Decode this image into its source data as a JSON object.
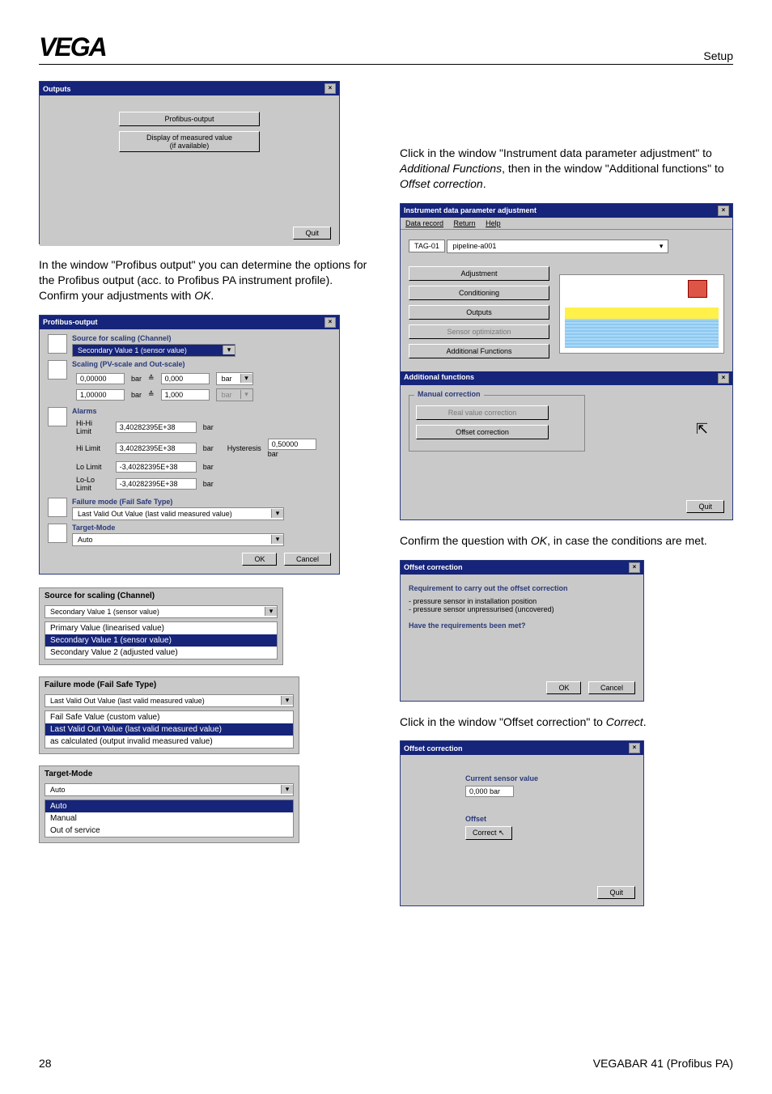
{
  "header": {
    "logo": "VEGA",
    "section": "Setup"
  },
  "left": {
    "win_outputs": {
      "title": "Outputs",
      "btn_profibus": "Profibus-output",
      "btn_display": "Display of measured value",
      "btn_avail": "(if available)",
      "quit": "Quit"
    },
    "para1a": "In the window \"Profibus output\" you can determine the options for the Profibus output (acc. to Profibus PA instrument profile). Confirm your adjustments with ",
    "para1b": ".",
    "ok_italic": "OK",
    "win_pb": {
      "title": "Profibus-output",
      "src_label": "Source for scaling (Channel)",
      "src_value": "Secondary Value 1 (sensor value)",
      "scale_label": "Scaling (PV-scale and Out-scale)",
      "row1_in": "0,00000",
      "row1_u1": "bar",
      "row1_eq": "≙",
      "row1_out": "0,000",
      "row1_u2": "bar",
      "row2_in": "1,00000",
      "row2_u1": "bar",
      "row2_eq": "≙",
      "row2_out": "1,000",
      "row2_u2": "bar",
      "alarms_label": "Alarms",
      "hihi": "Hi-Hi Limit",
      "hihi_v": "3,40282395E+38",
      "hihi_u": "bar",
      "hi": "Hi Limit",
      "hi_v": "3,40282395E+38",
      "hi_u": "bar",
      "hyst": "Hysteresis",
      "hyst_v": "0,50000",
      "hyst_u": "bar",
      "lo": "Lo Limit",
      "lo_v": "-3,40282395E+38",
      "lo_u": "bar",
      "lolo": "Lo-Lo Limit",
      "lolo_v": "-3,40282395E+38",
      "lolo_u": "bar",
      "fail_label": "Failure mode (Fail Safe Type)",
      "fail_value": "Last Valid Out Value (last valid measured value)",
      "target_label": "Target-Mode",
      "target_value": "Auto",
      "ok": "OK",
      "cancel": "Cancel"
    },
    "panel_src": {
      "title": "Source for scaling (Channel)",
      "selected": "Secondary Value 1 (sensor value)",
      "opts": [
        "Primary Value (linearised value)",
        "Secondary Value 1 (sensor value)",
        "Secondary Value 2 (adjusted value)"
      ]
    },
    "panel_fail": {
      "title": "Failure mode (Fail Safe Type)",
      "selected": "Last Valid Out Value (last valid measured value)",
      "opts": [
        "Fail Safe Value (custom value)",
        "Last Valid Out Value (last valid measured value)",
        "as calculated (output invalid measured value)"
      ]
    },
    "panel_target": {
      "title": "Target-Mode",
      "selected": "Auto",
      "opts": [
        "Auto",
        "Manual",
        "Out of service"
      ]
    }
  },
  "right": {
    "para1": "Click in the window \"Instrument data parameter adjustment\" to ",
    "italic1": "Additional Functions",
    "para1b": ", then in the window \"Additional functions\" to ",
    "italic2": "Offset correction",
    "para1c": ".",
    "win_idpa": {
      "title": "Instrument data parameter adjustment",
      "menu_dr": "Data record",
      "menu_ret": "Return",
      "menu_help": "Help",
      "tag": "TAG-01",
      "pipe": "pipeline-a001",
      "btn_adj": "Adjustment",
      "btn_cond": "Conditioning",
      "btn_out": "Outputs",
      "btn_sopt": "Sensor optimization",
      "btn_af": "Additional Functions"
    },
    "win_af": {
      "title": "Additional functions",
      "group": "Manual correction",
      "btn_real": "Real value correction",
      "btn_off": "Offset correction",
      "quit": "Quit"
    },
    "para2a": "Confirm the question with ",
    "italic3": "OK",
    "para2b": ", in case the conditions are met.",
    "win_req": {
      "title": "Offset correction",
      "req": "Requirement to carry out the offset correction",
      "l1": "- pressure sensor in installation position",
      "l2": "- pressure sensor unpressurised (uncovered)",
      "q": "Have the requirements been met?",
      "ok": "OK",
      "cancel": "Cancel"
    },
    "para3a": "Click in the window \"Offset correction\" to ",
    "italic4": "Correct",
    "para3b": ".",
    "win_oc": {
      "title": "Offset correction",
      "cur_label": "Current sensor value",
      "cur_val": "0,000 bar",
      "off_label": "Offset",
      "correct": "Correct",
      "quit": "Quit"
    }
  },
  "footer": {
    "page": "28",
    "doc": "VEGABAR 41 (Profibus PA)"
  }
}
